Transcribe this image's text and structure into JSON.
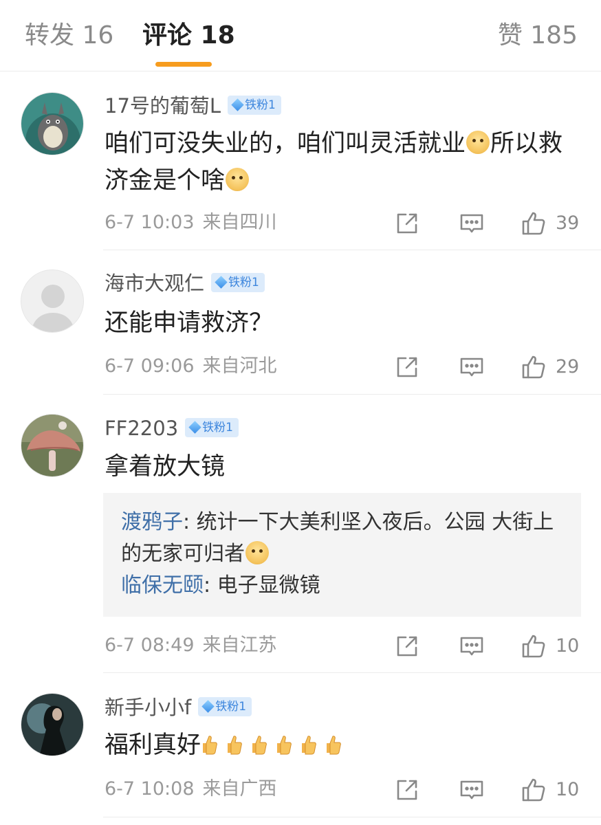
{
  "tabs": {
    "repost": "转发 16",
    "comment": "评论 18",
    "like": "赞 185"
  },
  "comments": [
    {
      "username": "17号的葡萄L",
      "badge": "铁粉1",
      "text_a": "咱们可没失业的，咱们叫灵活就业",
      "text_b": "所以救济金是个啥",
      "time": "6-7 10:03",
      "location": "来自四川",
      "likes": "39"
    },
    {
      "username": "海市大观仁",
      "badge": "铁粉1",
      "text_a": "还能申请救济？",
      "time": "6-7 09:06",
      "location": "来自河北",
      "likes": "29"
    },
    {
      "username": "FF2203",
      "badge": "铁粉1",
      "text_a": "拿着放大镜",
      "replies": [
        {
          "name": "渡鸦子",
          "sep": ": ",
          "text": "统计一下大美利坚入夜后。公园 大街上的无家可归者"
        },
        {
          "name": "临保无颐",
          "sep": ": ",
          "text": "电子显微镜"
        }
      ],
      "time": "6-7 08:49",
      "location": "来自江苏",
      "likes": "10"
    },
    {
      "username": "新手小小f",
      "badge": "铁粉1",
      "text_a": "福利真好",
      "time": "6-7 10:08",
      "location": "来自广西",
      "likes": "10"
    }
  ],
  "icons": {
    "share": "share-icon",
    "comment": "comment-icon",
    "like": "thumbs-up-icon",
    "emoji": "doge-emoji",
    "thumb_emoji": "thumbs-up-emoji"
  },
  "colors": {
    "accent": "#f79c1e",
    "badge_bg": "#dcebfb",
    "badge_text": "#3d86dd",
    "reply_name": "#3f6fa8"
  }
}
